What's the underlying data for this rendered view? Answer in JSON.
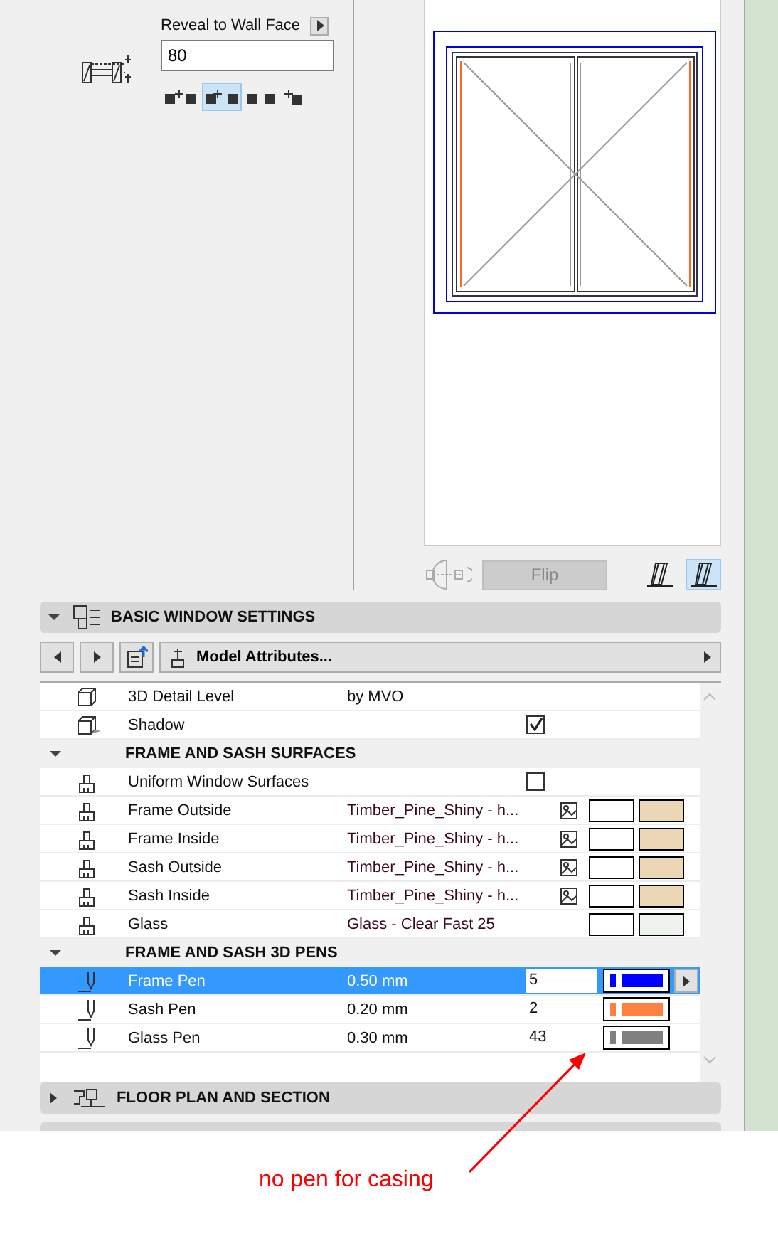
{
  "reveal": {
    "label": "Reveal to Wall Face",
    "value": "80",
    "options": [
      {
        "selected": false
      },
      {
        "selected": true
      },
      {
        "selected": false
      },
      {
        "selected": false
      }
    ]
  },
  "preview": {
    "flip_label": "Flip",
    "flip_disabled": true,
    "views": [
      {
        "selected": false
      },
      {
        "selected": true
      }
    ]
  },
  "panel": {
    "title": "BASIC WINDOW SETTINGS",
    "expanded": true,
    "attributes_label": "Model Attributes...",
    "rows": [
      {
        "kind": "value",
        "name": "3D Detail Level",
        "value": "by MVO"
      },
      {
        "kind": "checkbox",
        "name": "Shadow",
        "checked": true
      },
      {
        "kind": "group",
        "name": "FRAME AND SASH SURFACES",
        "expanded": true,
        "children": [
          {
            "kind": "checkbox",
            "name": "Uniform Window Surfaces",
            "checked": false
          },
          {
            "kind": "surface",
            "name": "Frame Outside",
            "material": "Timber_Pine_Shiny - h...",
            "textured": true,
            "color": "#ebd6b6"
          },
          {
            "kind": "surface",
            "name": "Frame Inside",
            "material": "Timber_Pine_Shiny - h...",
            "textured": true,
            "color": "#ebd6b6"
          },
          {
            "kind": "surface",
            "name": "Sash Outside",
            "material": "Timber_Pine_Shiny - h...",
            "textured": true,
            "color": "#ebd6b6"
          },
          {
            "kind": "surface",
            "name": "Sash Inside",
            "material": "Timber_Pine_Shiny - h...",
            "textured": true,
            "color": "#ebd6b6"
          },
          {
            "kind": "surface",
            "name": "Glass",
            "material": "Glass - Clear Fast 25",
            "textured": false,
            "color": "#eef3ee"
          }
        ]
      },
      {
        "kind": "group",
        "name": "FRAME AND SASH 3D PENS",
        "expanded": true,
        "children": [
          {
            "kind": "pen",
            "name": "Frame Pen",
            "width": "0.50 mm",
            "number": "5",
            "color": "#0000ff",
            "selected": true
          },
          {
            "kind": "pen",
            "name": "Sash Pen",
            "width": "0.20 mm",
            "number": "2",
            "color": "#ff8040",
            "selected": false
          },
          {
            "kind": "pen",
            "name": "Glass Pen",
            "width": "0.30 mm",
            "number": "43",
            "color": "#808080",
            "selected": false
          }
        ]
      }
    ]
  },
  "collapsed_panels": [
    {
      "title": "FLOOR PLAN AND SECTION",
      "expanded": false
    }
  ],
  "annotation": {
    "text": "no pen for casing"
  }
}
